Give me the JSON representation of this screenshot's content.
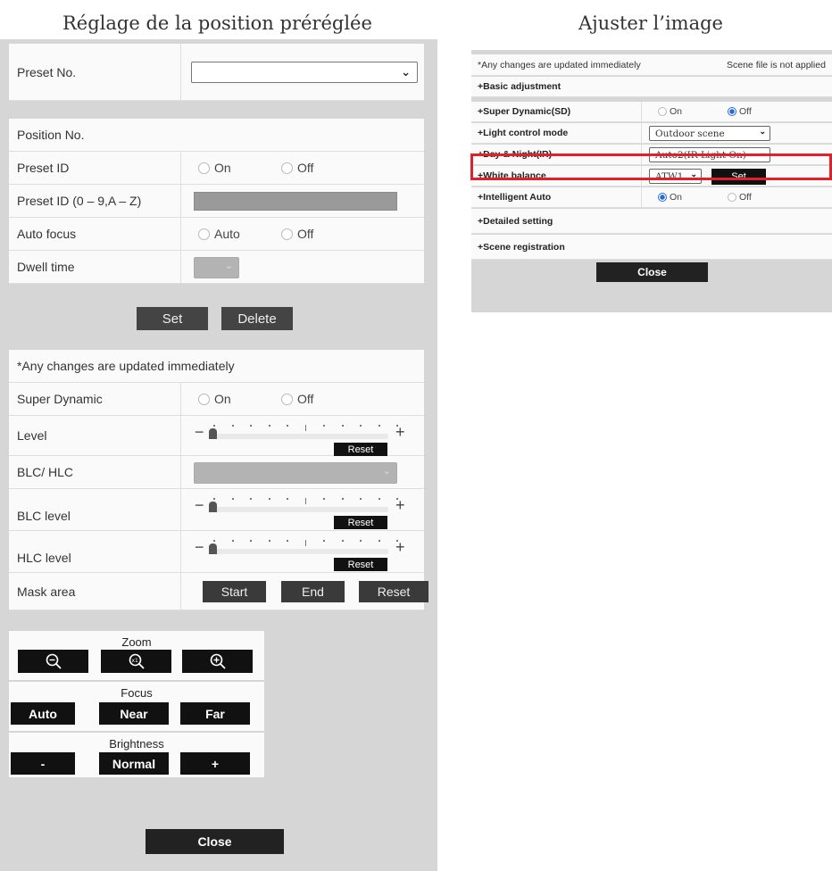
{
  "captions": {
    "left": "Réglage de la position préréglée",
    "right": "Ajuster l’image"
  },
  "preset": {
    "preset_no_label": "Preset No.",
    "preset_no_value": "",
    "position_no_label": "Position No.",
    "preset_id_label": "Preset ID",
    "preset_id_on": "On",
    "preset_id_off": "Off",
    "preset_id_chars_label": "Preset ID (0 – 9,A – Z)",
    "auto_focus_label": "Auto focus",
    "auto_focus_auto": "Auto",
    "auto_focus_off": "Off",
    "dwell_time_label": "Dwell time",
    "set_button": "Set",
    "delete_button": "Delete"
  },
  "image": {
    "notice": "*Any changes are updated immediately",
    "super_dynamic_label": "Super Dynamic",
    "super_dynamic_on": "On",
    "super_dynamic_off": "Off",
    "level_label": "Level",
    "blc_hlc_label": "BLC/ HLC",
    "blc_level_label": "BLC level",
    "hlc_level_label": "HLC level",
    "reset_label": "Reset",
    "level_value": 0,
    "blc_level_value": 0,
    "hlc_level_value": 0,
    "mask_area_label": "Mask area",
    "mask_start": "Start",
    "mask_end": "End",
    "mask_reset": "Reset"
  },
  "camera_controls": {
    "zoom_title": "Zoom",
    "focus_title": "Focus",
    "focus_auto": "Auto",
    "focus_near": "Near",
    "focus_far": "Far",
    "brightness_title": "Brightness",
    "brightness_minus": "-",
    "brightness_normal": "Normal",
    "brightness_plus": "+",
    "zoom_icons": [
      "zoom-out-icon",
      "zoom-1x-icon",
      "zoom-in-icon"
    ],
    "close_button": "Close"
  },
  "adjust": {
    "notice": "*Any changes are updated immediately",
    "scene_notice": "Scene file is not applied",
    "basic_adjustment": "+Basic adjustment",
    "super_dynamic_label": "+Super Dynamic(SD)",
    "sd_on": "On",
    "sd_off": "Off",
    "sd_selected": "Off",
    "light_control_label": "+Light control mode",
    "light_control_value": "Outdoor scene",
    "day_night_label": "+Day & Night(IR)",
    "day_night_value": "Auto2(IR Light On)",
    "white_balance_label": "+White balance",
    "white_balance_value": "ATW1",
    "white_balance_set": "Set",
    "intelligent_auto_label": "+Intelligent Auto",
    "ia_on": "On",
    "ia_off": "Off",
    "ia_selected": "On",
    "detailed_setting": "+Detailed setting",
    "scene_registration": "+Scene registration",
    "close_button": "Close"
  },
  "colors": {
    "highlight": "#e0202a",
    "radio_selected": "#2a6ad8",
    "panel_bg": "#d6d6d6"
  }
}
